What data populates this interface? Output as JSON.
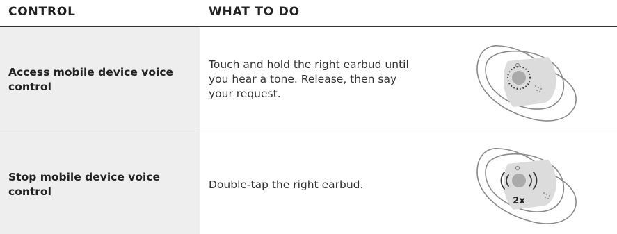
{
  "table": {
    "headers": {
      "control": "CONTROL",
      "what_to_do": "WHAT TO DO"
    },
    "rows": [
      {
        "control": "Access mobile device voice control",
        "instruction": "Touch and hold the right earbud until you hear a tone. Release, then say your request.",
        "illustration_icon": "earbud-touch-hold-icon"
      },
      {
        "control": "Stop mobile device voice control",
        "instruction": "Double-tap the right earbud.",
        "illustration_icon": "earbud-double-tap-icon",
        "illustration_badge": "2x"
      }
    ]
  },
  "colors": {
    "label_column_bg": "#eeeeee",
    "header_rule": "#333333",
    "row_divider": "#bbbbbb",
    "earbud_outline": "#8a8a8a",
    "touch_panel": "#dcdcdc"
  }
}
